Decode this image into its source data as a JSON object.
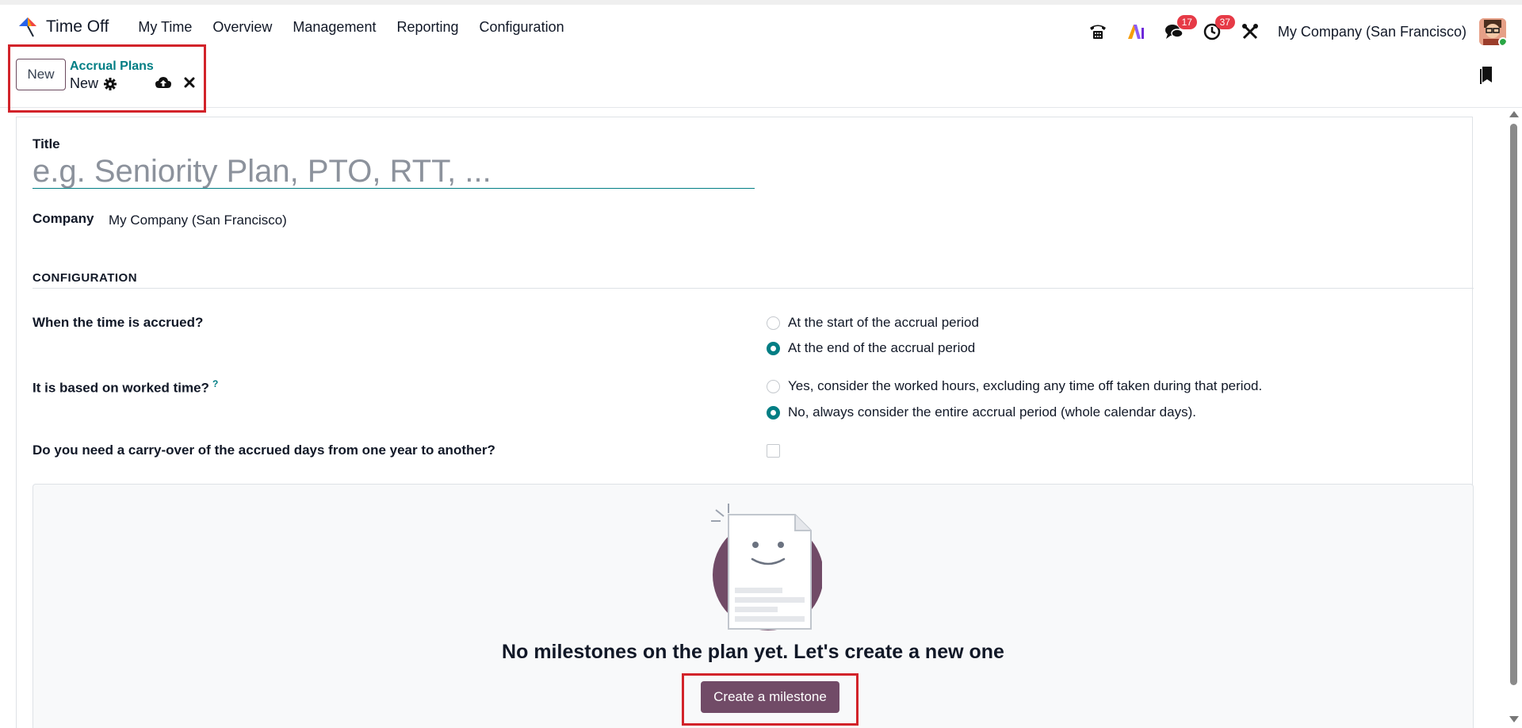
{
  "app": {
    "name": "Time Off"
  },
  "menu": [
    {
      "label": "My Time"
    },
    {
      "label": "Overview"
    },
    {
      "label": "Management"
    },
    {
      "label": "Reporting"
    },
    {
      "label": "Configuration"
    }
  ],
  "systray": {
    "messages_count": "17",
    "activities_count": "37",
    "company": "My Company (San Francisco)"
  },
  "control_panel": {
    "new_label": "New",
    "breadcrumb": "Accrual Plans",
    "record_name": "New"
  },
  "form": {
    "title_label": "Title",
    "title_placeholder": "e.g. Seniority Plan, PTO, RTT, ...",
    "company_label": "Company",
    "company_value": "My Company (San Francisco)",
    "section_title": "CONFIGURATION",
    "q1": {
      "label": "When the time is accrued?",
      "options": [
        "At the start of the accrual period",
        "At the end of the accrual period"
      ],
      "selected": 1
    },
    "q2": {
      "label": "It is based on worked time?",
      "help": "?",
      "options": [
        "Yes, consider the worked hours, excluding any time off taken during that period.",
        "No, always consider the entire accrual period (whole calendar days)."
      ],
      "selected": 1
    },
    "q3": {
      "label": "Do you need a carry-over of the accrued days from one year to another?",
      "checked": false
    }
  },
  "milestones": {
    "empty_text": "No milestones on the plan yet. Let's create a new one",
    "create_label": "Create a milestone"
  },
  "colors": {
    "primary": "#714b67",
    "accent": "#017e84",
    "badge": "#e63a46",
    "highlight": "#d2232a"
  }
}
